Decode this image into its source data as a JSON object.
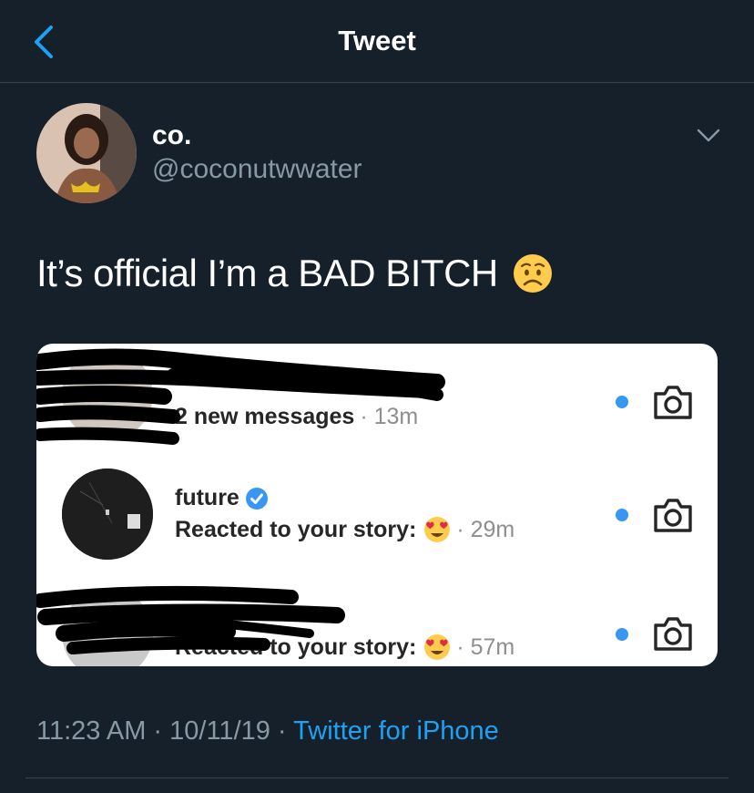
{
  "header": {
    "title": "Tweet"
  },
  "tweet": {
    "display_name": "co.",
    "handle": "@coconutwwater",
    "text": "It’s official I’m a BAD BITCH",
    "timestamp": "11:23 AM · 10/11/19 · ",
    "source": "Twitter for iPhone"
  },
  "dm_screenshot": {
    "rows": [
      {
        "subtitle": "2 new messages",
        "time": "· 13m"
      },
      {
        "username": "future",
        "subtitle": "Reacted to your story:",
        "time": "· 29m"
      },
      {
        "subtitle": "Reacted to your story:",
        "time": "· 57m"
      }
    ]
  },
  "colors": {
    "background": "#15202b",
    "accent": "#1da1f2",
    "muted": "#8899a6",
    "ig_blue": "#3897f0"
  }
}
